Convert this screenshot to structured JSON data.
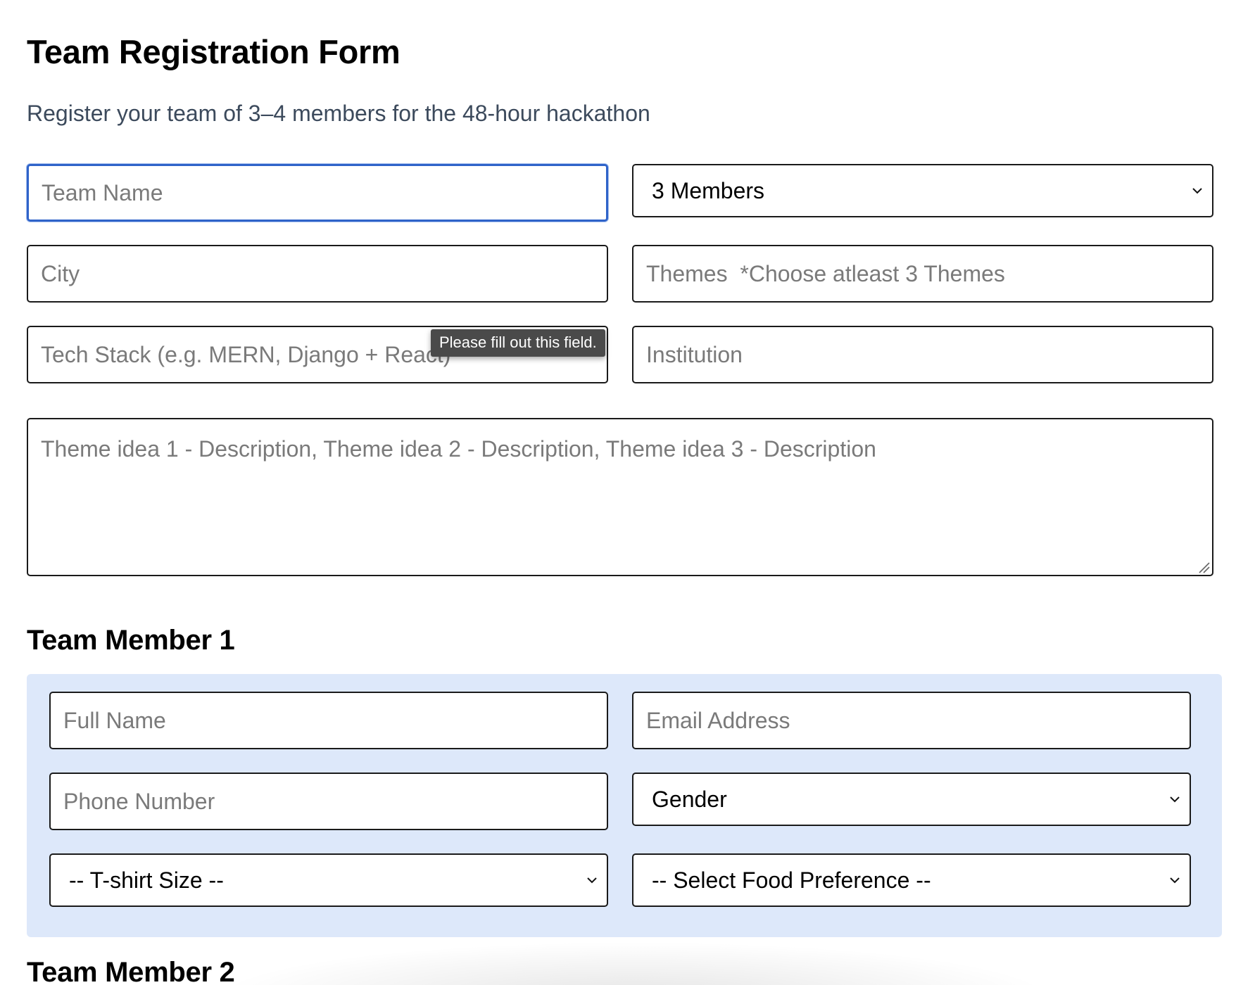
{
  "form": {
    "title": "Team Registration Form",
    "subtitle": "Register your team of 3–4 members for the 48-hour hackathon",
    "team_name_placeholder": "Team Name",
    "team_size_value": "3 Members",
    "city_placeholder": "City",
    "themes_placeholder": "Themes  *Choose atleast 3 Themes",
    "tech_stack_placeholder": "Tech Stack (e.g. MERN, Django + React)",
    "institution_placeholder": "Institution",
    "theme_ideas_placeholder": "Theme idea 1 - Description, Theme idea 2 - Description, Theme idea 3 - Description",
    "validation_tooltip": "Please fill out this field."
  },
  "member1": {
    "heading": "Team Member 1",
    "full_name_placeholder": "Full Name",
    "email_placeholder": "Email Address",
    "phone_placeholder": "Phone Number",
    "gender_value": "Gender",
    "tshirt_value": "-- T-shirt Size --",
    "food_value": "-- Select Food Preference --"
  },
  "member2": {
    "heading": "Team Member 2"
  },
  "icons": {
    "select_chevron": "chevron-down-icon",
    "textarea_grip": "resize-grip-icon"
  },
  "colors": {
    "focus_border": "#2f63c9",
    "member_card_bg": "#dde8fa",
    "subtitle_text": "#3c4a5c",
    "tooltip_bg": "#4a4a4a"
  }
}
